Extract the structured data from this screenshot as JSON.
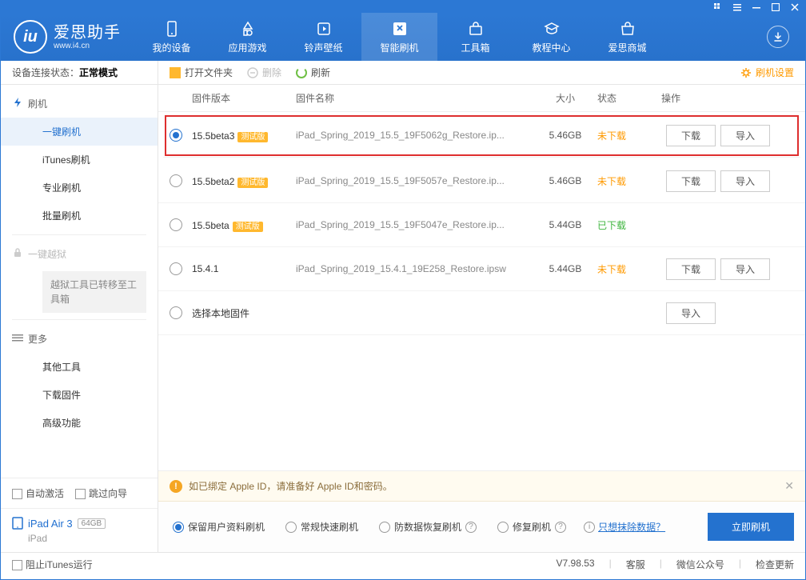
{
  "window": {
    "controls": [
      "grid",
      "menu",
      "min",
      "max",
      "close"
    ]
  },
  "brand": {
    "title": "爱思助手",
    "sub": "www.i4.cn",
    "logo_letter": "iu"
  },
  "nav": [
    {
      "id": "device",
      "label": "我的设备"
    },
    {
      "id": "apps",
      "label": "应用游戏"
    },
    {
      "id": "ring",
      "label": "铃声壁纸"
    },
    {
      "id": "flash",
      "label": "智能刷机",
      "active": true
    },
    {
      "id": "tools",
      "label": "工具箱"
    },
    {
      "id": "tutorial",
      "label": "教程中心"
    },
    {
      "id": "store",
      "label": "爱思商城"
    }
  ],
  "subbar": {
    "status_label": "设备连接状态：",
    "status_value": "正常模式",
    "open_folder": "打开文件夹",
    "delete": "删除",
    "refresh": "刷新",
    "settings": "刷机设置"
  },
  "sidebar": {
    "flash_section": "刷机",
    "one_click": "一键刷机",
    "itunes": "iTunes刷机",
    "pro": "专业刷机",
    "batch": "批量刷机",
    "jailbreak_section": "一键越狱",
    "jailbreak_note": "越狱工具已转移至工具箱",
    "more_section": "更多",
    "other_tools": "其他工具",
    "download_fw": "下载固件",
    "advanced": "高级功能",
    "auto_activate": "自动激活",
    "skip_guide": "跳过向导",
    "device_name": "iPad Air 3",
    "device_capacity": "64GB",
    "device_type": "iPad"
  },
  "columns": {
    "version": "固件版本",
    "name": "固件名称",
    "size": "大小",
    "status": "状态",
    "action": "操作"
  },
  "firmware": [
    {
      "selected": true,
      "highlighted": true,
      "version": "15.5beta3",
      "beta": true,
      "name": "iPad_Spring_2019_15.5_19F5062g_Restore.ip...",
      "size": "5.46GB",
      "status": "未下载",
      "status_class": "need",
      "download": true,
      "import": true
    },
    {
      "selected": false,
      "version": "15.5beta2",
      "beta": true,
      "name": "iPad_Spring_2019_15.5_19F5057e_Restore.ip...",
      "size": "5.46GB",
      "status": "未下载",
      "status_class": "need",
      "download": true,
      "import": true
    },
    {
      "selected": false,
      "version": "15.5beta",
      "beta": true,
      "name": "iPad_Spring_2019_15.5_19F5047e_Restore.ip...",
      "size": "5.44GB",
      "status": "已下载",
      "status_class": "done",
      "download": false,
      "import": false
    },
    {
      "selected": false,
      "version": "15.4.1",
      "beta": false,
      "name": "iPad_Spring_2019_15.4.1_19E258_Restore.ipsw",
      "size": "5.44GB",
      "status": "未下载",
      "status_class": "need",
      "download": true,
      "import": true
    },
    {
      "selected": false,
      "version": "选择本地固件",
      "beta": false,
      "name": "",
      "size": "",
      "status": "",
      "status_class": "",
      "download": false,
      "import": true,
      "local": true
    }
  ],
  "buttons": {
    "download": "下载",
    "import": "导入",
    "beta_tag": "测试版"
  },
  "notice": {
    "text": "如已绑定 Apple ID，请准备好 Apple ID和密码。"
  },
  "modes": [
    {
      "label": "保留用户资料刷机",
      "selected": true,
      "help": false
    },
    {
      "label": "常规快速刷机",
      "selected": false,
      "help": false
    },
    {
      "label": "防数据恢复刷机",
      "selected": false,
      "help": true
    },
    {
      "label": "修复刷机",
      "selected": false,
      "help": true
    }
  ],
  "erase_link": "只想抹除数据？",
  "flash_now": "立即刷机",
  "footer": {
    "block_itunes": "阻止iTunes运行",
    "version": "V7.98.53",
    "support": "客服",
    "wechat": "微信公众号",
    "check_update": "检查更新"
  }
}
